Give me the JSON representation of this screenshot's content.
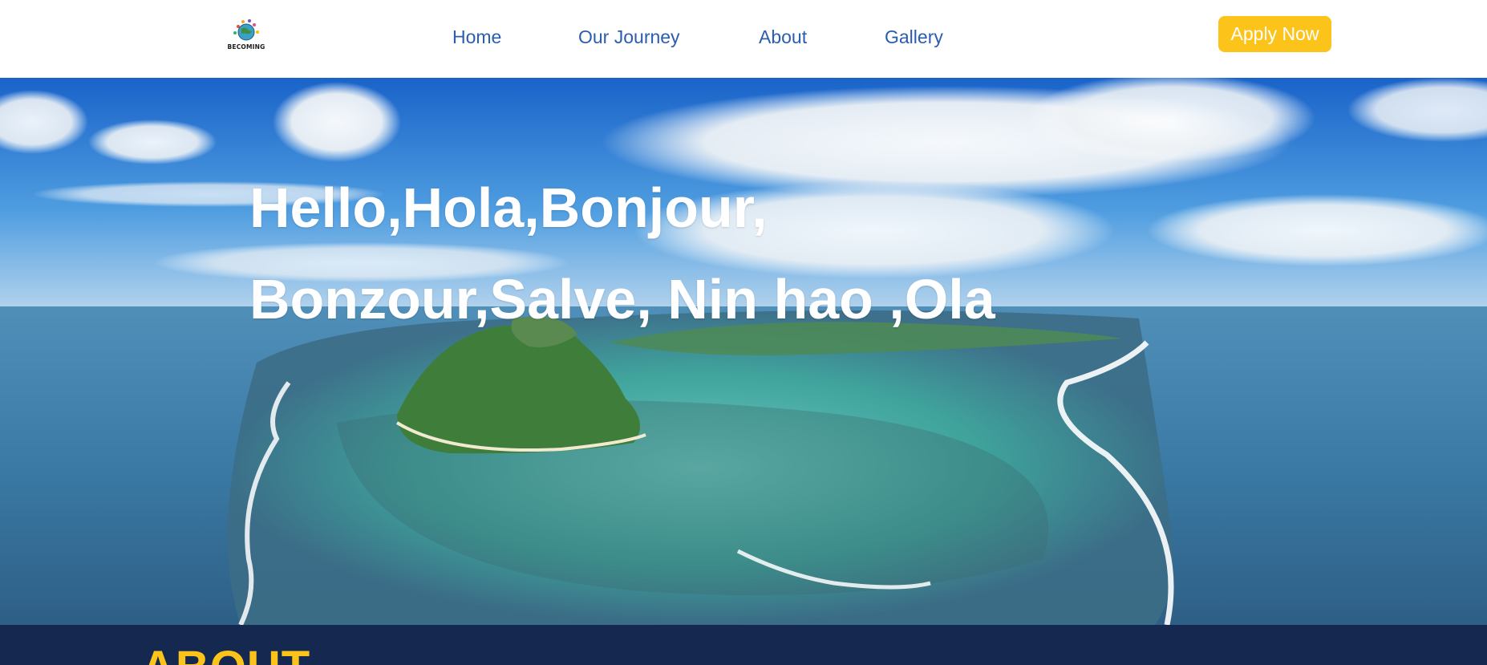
{
  "header": {
    "logo_text": "BECOMING",
    "nav": [
      "Home",
      "Our Journey",
      "About",
      "Gallery"
    ],
    "apply_label": "Apply Now"
  },
  "hero": {
    "line1": "Hello,Hola,Bonjour,",
    "line2": "Bonzour,Salve, Nin hao ,Ola"
  },
  "about": {
    "title": "ABOUT"
  },
  "colors": {
    "nav_link": "#2a5db0",
    "accent": "#fcc31b",
    "about_bg": "#142850"
  }
}
